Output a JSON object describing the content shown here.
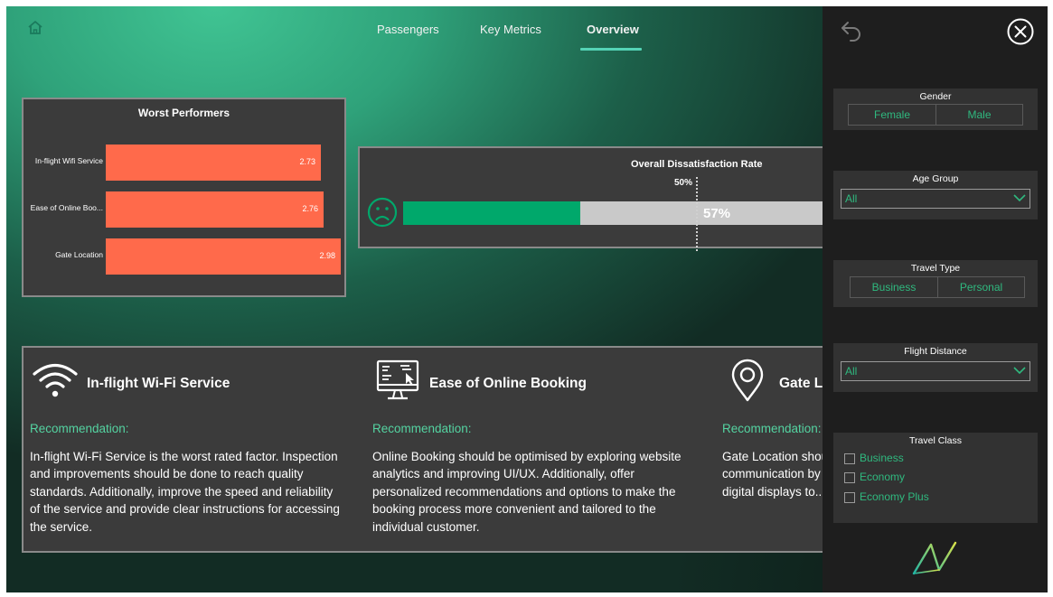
{
  "tabs": [
    {
      "label": "Passengers"
    },
    {
      "label": "Key Metrics"
    },
    {
      "label": "Overview",
      "active": true
    }
  ],
  "worst_performers": {
    "title": "Worst Performers",
    "items": [
      {
        "label": "In-flight Wifi Service",
        "value": "2.73"
      },
      {
        "label": "Ease of Online Boo...",
        "value": "2.76"
      },
      {
        "label": "Gate Location",
        "value": "2.98"
      }
    ]
  },
  "chart_data": {
    "type": "bar",
    "title": "Worst Performers",
    "orientation": "horizontal",
    "categories": [
      "In-flight Wifi Service",
      "Ease of Online Boo...",
      "Gate Location"
    ],
    "values": [
      2.73,
      2.76,
      2.98
    ],
    "xlabel": "",
    "ylabel": "",
    "grid": false
  },
  "dissatisfaction": {
    "title": "Overall Dissatisfaction Rate",
    "value_label": "57%",
    "value": 0.57,
    "target_label": "50%",
    "target": 0.5
  },
  "recommendations": [
    {
      "icon": "wifi-icon",
      "title": "In-flight Wi-Fi Service",
      "label": "Recommendation:",
      "text": "In-flight Wi-Fi Service is the worst rated factor. Inspection and improvements should be done to reach quality standards. Additionally, improve the speed and reliability of the service and provide clear instructions for accessing the service."
    },
    {
      "icon": "online-booking-icon",
      "title": "Ease of Online Booking",
      "label": "Recommendation:",
      "text": "Online Booking should be optimised by exploring website analytics and improving UI/UX. Additionally, offer personalized recommendations and options to make the booking process more convenient and tailored to the individual customer."
    },
    {
      "icon": "location-pin-icon",
      "title": "Gate Location",
      "label": "Recommendation:",
      "text": "Gate Location should be improved by allowing for smooth communication by providing real-time information, use t... digital displays to..."
    }
  ],
  "filters": {
    "gender": {
      "title": "Gender",
      "options": [
        "Female",
        "Male"
      ]
    },
    "age_group": {
      "title": "Age Group",
      "value": "All"
    },
    "travel_type": {
      "title": "Travel Type",
      "options": [
        "Business",
        "Personal"
      ]
    },
    "flight_distance": {
      "title": "Flight Distance",
      "value": "All"
    },
    "travel_class": {
      "title": "Travel Class",
      "options": [
        "Business",
        "Economy",
        "Economy Plus"
      ]
    }
  },
  "colors": {
    "accent": "#54d3b6",
    "bar": "#ff6a4b",
    "gauge_fill": "#00a86b",
    "filter_text": "#2fb97f",
    "panel_bg": "#1e1e1e",
    "card_bg": "#3b3b3b"
  }
}
